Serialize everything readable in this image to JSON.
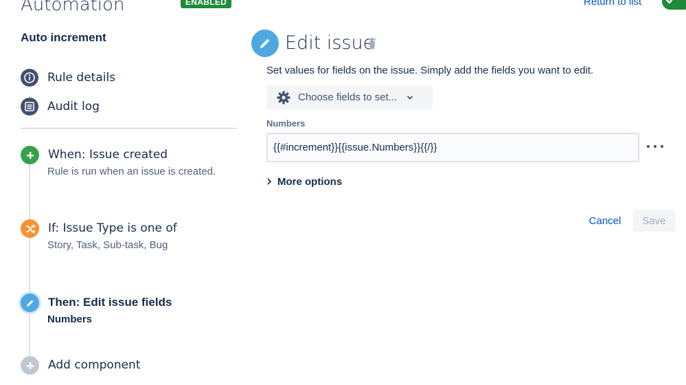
{
  "header": {
    "app_title": "Automation",
    "status_badge": "ENABLED",
    "return_link": "Return to list"
  },
  "sidebar": {
    "rule_name": "Auto increment",
    "nav": [
      {
        "label": "Rule details",
        "icon": "info-icon"
      },
      {
        "label": "Audit log",
        "icon": "list-icon"
      }
    ],
    "steps": [
      {
        "title": "When: Issue created",
        "subtitle": "Rule is run when an issue is created.",
        "icon": "plus-icon",
        "color": "#36a14b"
      },
      {
        "title": "If: Issue Type is one of",
        "subtitle": "Story, Task, Sub-task, Bug",
        "icon": "shuffle-icon",
        "color": "#f79232"
      },
      {
        "title": "Then: Edit issue fields",
        "subtitle": "Numbers",
        "icon": "pencil-icon",
        "color": "#4fa8e0"
      },
      {
        "title": "Add component",
        "subtitle": "",
        "icon": "plus-icon",
        "color": "#c1c7d0"
      }
    ]
  },
  "editor": {
    "title": "Edit issue",
    "description": "Set values for fields on the issue. Simply add the fields you want to edit.",
    "choose_fields_label": "Choose fields to set...",
    "field_label": "Numbers",
    "field_value": "{{#increment}}{{issue.Numbers}}{{/}}",
    "more_options_label": "More options",
    "cancel_label": "Cancel",
    "save_label": "Save"
  },
  "colors": {
    "accent": "#0052cc",
    "enabled": "#1f8a3a",
    "edit_blue": "#4fa8e0"
  }
}
